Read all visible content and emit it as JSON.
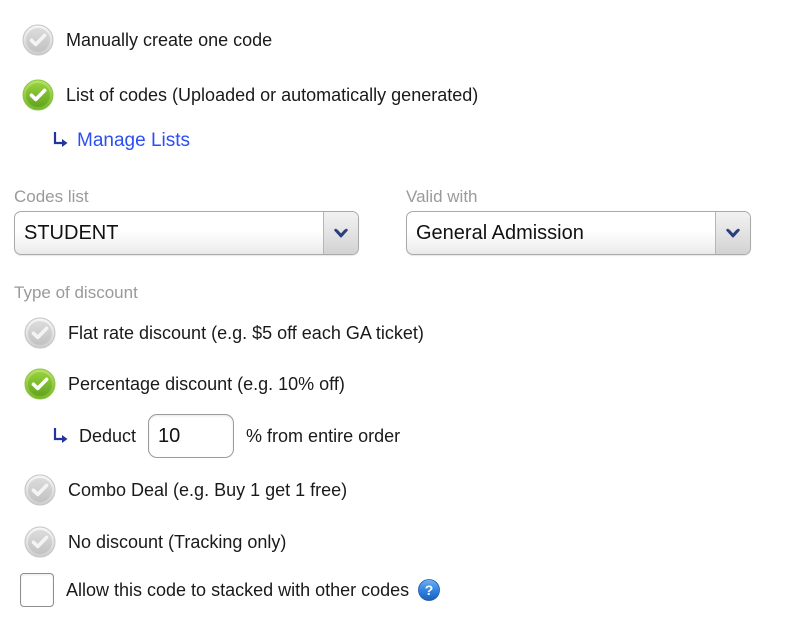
{
  "code_source": {
    "options": [
      {
        "label": "Manually create one code",
        "selected": false
      },
      {
        "label": "List of codes (Uploaded or automatically generated)",
        "selected": true
      }
    ],
    "manage_link": "Manage Lists"
  },
  "fields": {
    "codes_list": {
      "label": "Codes list",
      "value": "STUDENT"
    },
    "valid_with": {
      "label": "Valid with",
      "value": "General Admission"
    }
  },
  "discount": {
    "section_label": "Type of discount",
    "options": [
      {
        "label": "Flat rate discount (e.g. $5 off each GA ticket)",
        "selected": false
      },
      {
        "label": "Percentage discount (e.g. 10% off)",
        "selected": true
      },
      {
        "label": "Combo Deal (e.g. Buy 1 get 1 free)",
        "selected": false
      },
      {
        "label": "No discount (Tracking only)",
        "selected": false
      }
    ],
    "deduct": {
      "prefix": "Deduct",
      "value": "10",
      "suffix": "% from entire order"
    }
  },
  "stacking": {
    "label": "Allow this code to stacked with other codes",
    "checked": false,
    "help_tooltip": "?"
  },
  "colors": {
    "selected_green": "#7ac143",
    "unselected_grey": "#cfcfcf",
    "link_blue": "#2b4ef5",
    "arrow_navy": "#22359e",
    "help_blue": "#2f7fe0",
    "label_grey": "#9a9a9a"
  }
}
